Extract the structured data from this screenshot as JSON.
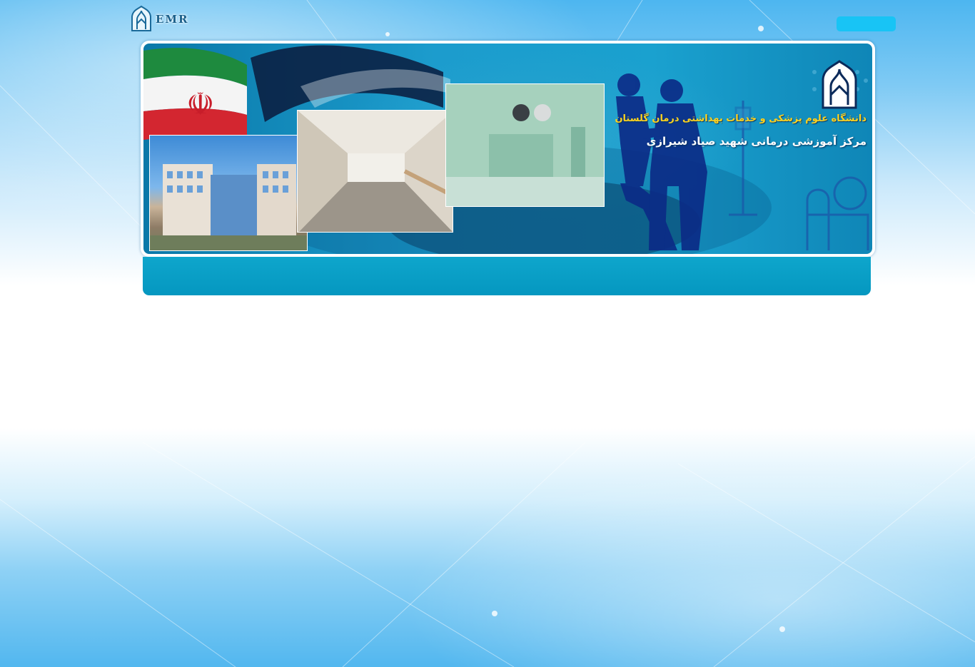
{
  "header": {
    "logo_text": "EMR"
  },
  "banner": {
    "university_name": "دانشگاه علوم پزشکی و خدمات بهداشتی درمان گلستان",
    "center_name": "مرکز آموزشی درمانی شهید صیاد شیرازی"
  },
  "colors": {
    "accent": "#18c4f5",
    "nav_bar": "#0597c0",
    "university_title": "#ffd21f",
    "banner_base": "#1c9ccd"
  },
  "icons": {
    "site_logo": "university-emblem-icon",
    "flag": "iran-flag-icon"
  }
}
